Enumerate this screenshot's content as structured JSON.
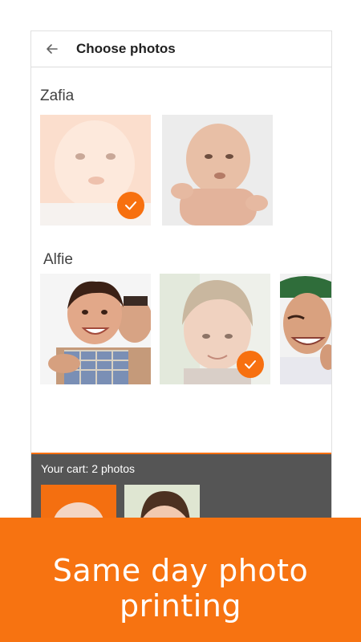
{
  "header": {
    "title": "Choose photos",
    "back_icon": "arrow-left-icon"
  },
  "albums": [
    {
      "name": "Zafia",
      "photos": [
        {
          "selected": true
        },
        {
          "selected": false
        }
      ]
    },
    {
      "name": "Alfie",
      "photos": [
        {
          "selected": false
        },
        {
          "selected": true
        },
        {
          "selected": false
        }
      ]
    }
  ],
  "cart": {
    "label": "Your cart: 2 photos"
  },
  "banner": {
    "text": "Same day photo printing"
  },
  "colors": {
    "accent": "#f7700f",
    "cart_bg": "#555555",
    "banner_bg": "#f77311"
  }
}
